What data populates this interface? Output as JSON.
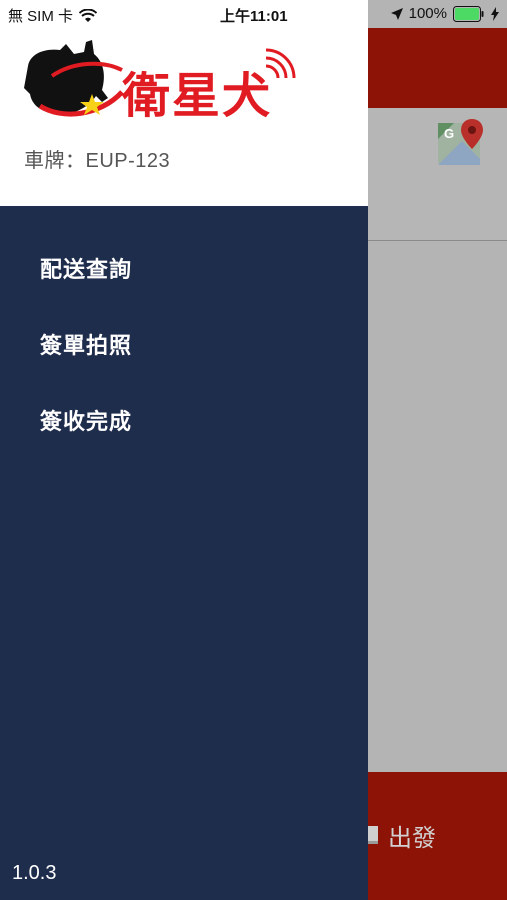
{
  "status_bar": {
    "carrier": "無 SIM 卡",
    "time": "上午11:01",
    "battery": "100%",
    "icons": [
      "wifi-icon",
      "location-arrow-icon",
      "battery-icon",
      "charging-bolt-icon"
    ]
  },
  "drawer": {
    "logo_text": "衛星犬",
    "plate": "車牌：EUP-123",
    "menu": [
      {
        "label": "配送查詢"
      },
      {
        "label": "簽單拍照"
      },
      {
        "label": "簽收完成"
      }
    ],
    "version": "1.0.3"
  },
  "background": {
    "depart_label": "出發",
    "maps_icon": "google-maps-icon"
  },
  "colors": {
    "drawer_bg": "#1f2d4d",
    "header_red": "#8c1306",
    "logo_red": "#e11b22",
    "battery_green": "#4cd964"
  }
}
